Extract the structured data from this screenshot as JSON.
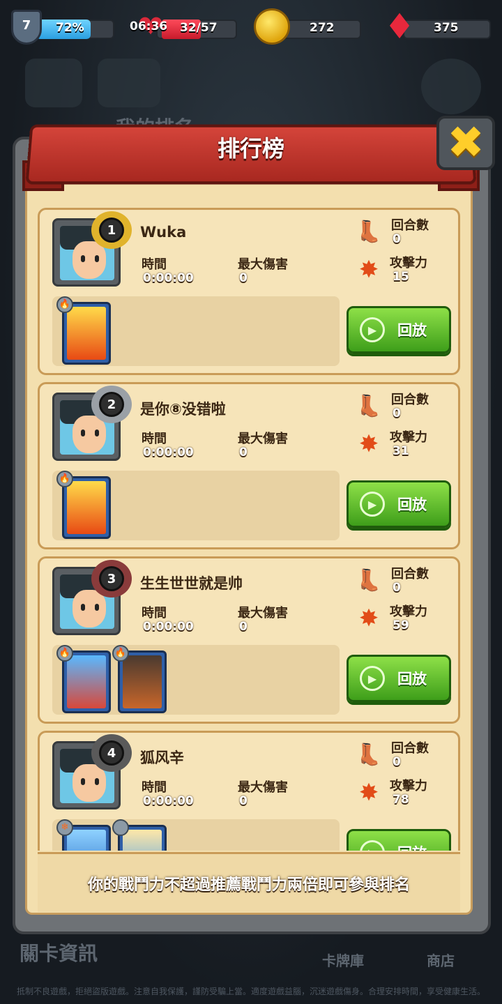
{
  "hud": {
    "level": "7",
    "xp_percent": "72%",
    "timer": "06:36",
    "energy": "32/57",
    "coins": "272",
    "gems": "375"
  },
  "background": {
    "my_rank_label": "我的排名",
    "stage_info": "關卡資訊",
    "card_library": "卡牌庫",
    "shop": "商店",
    "footer_notice": "抵制不良遊戲，拒絕盜版遊戲。注意自我保護，謹防受騙上當。適度遊戲益腦，沉迷遊戲傷身。合理安排時間，享受健康生活。"
  },
  "modal": {
    "title": "排行榜",
    "note": "你的戰鬥力不超過推薦戰鬥力兩倍即可參與排名",
    "labels": {
      "time": "時間",
      "max_damage": "最大傷害",
      "rounds": "回合數",
      "attack": "攻擊力",
      "replay": "回放"
    },
    "entries": [
      {
        "rank": "1",
        "name": "Wuka",
        "time": "0:00:00",
        "max_damage": "0",
        "rounds": "0",
        "attack": "15",
        "medal_color": "#e0b32c"
      },
      {
        "rank": "2",
        "name": "是你⑧没错啦",
        "time": "0:00:00",
        "max_damage": "0",
        "rounds": "0",
        "attack": "31",
        "medal_color": "#9aa0a6"
      },
      {
        "rank": "3",
        "name": "生生世世就是帅",
        "time": "0:00:00",
        "max_damage": "0",
        "rounds": "0",
        "attack": "59",
        "medal_color": "#8a3b3b"
      },
      {
        "rank": "4",
        "name": "狐风辛",
        "time": "0:00:00",
        "max_damage": "0",
        "rounds": "0",
        "attack": "78",
        "medal_color": "#5a5a5a"
      }
    ]
  }
}
